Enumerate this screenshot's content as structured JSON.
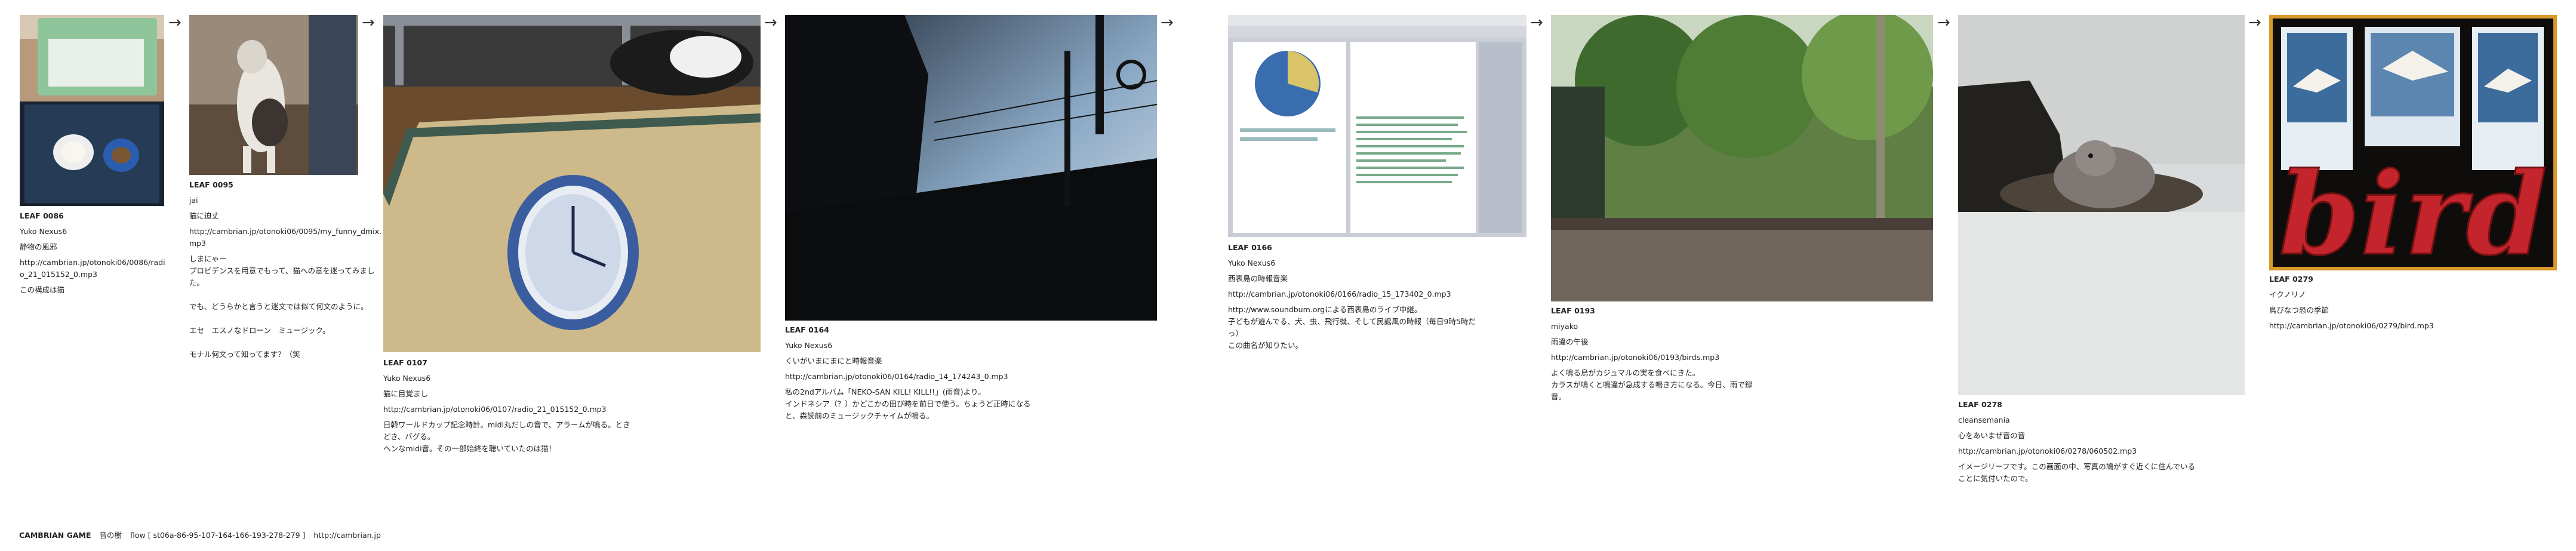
{
  "leaves": [
    {
      "id": "LEAF 0086",
      "author": "Yuko Nexus6",
      "title": "静物の風邪",
      "url": "http://cambrian.jp/otonoki06/0086/radio_21_015152_0.mp3",
      "desc": "この構成は猫"
    },
    {
      "id": "LEAF 0095",
      "author": "jai",
      "title": "猫に迫丈",
      "url": "http://cambrian.jp/otonoki06/0095/my_funny_dmix.mp3",
      "desc": "しまにゃー\nプロビデンスを用意でもって、猫への意を迷ってみました。\n\nでも、どうらかと言うと迷文では似て何文のように。\n\nエセ　エスノなドローン　ミュージック。\n\nモナル何文って知ってます？（笑"
    },
    {
      "id": "LEAF 0107",
      "author": "Yuko Nexus6",
      "title": "猫に目覚まし",
      "url": "http://cambrian.jp/otonoki06/0107/radio_21_015152_0.mp3",
      "desc": "日韓ワールドカップ記念時計。midi丸だしの音で、アラームが鳴る。ときどき、バグる。\nヘンなmidi音。その一部始終を聴いていたのは猫！"
    },
    {
      "id": "LEAF 0164",
      "author": "Yuko Nexus6",
      "title": "くいがいまにまにと時報音楽",
      "url": "http://cambrian.jp/otonoki06/0164/radio_14_174243_0.mp3",
      "desc": "私の2ndアルバム「NEKO-SAN KILL! KILL!!」(雨音)より。\nインドネシア（？）かどこかの田び時を前日で使う。ちょうど正時になると、森読前のミュージックチャイムが鳴る。"
    },
    {
      "id": "LEAF 0166",
      "author": "Yuko Nexus6",
      "title": "西表島の時報音楽",
      "url": "http://cambrian.jp/otonoki06/0166/radio_15_173402_0.mp3",
      "desc": "http://www.soundbum.orgによる西表島のライブ中継。\n子どもが遊んでる、犬、虫、飛行機、そして民謡風の時報（毎日9時5時だっ）\nこの曲名が知りたい。"
    },
    {
      "id": "LEAF 0193",
      "author": "miyako",
      "title": "雨違の午後",
      "url": "http://cambrian.jp/otonoki06/0193/birds.mp3",
      "desc": "よく鳴る鳥がカジュマルの実を食べにきた。\nカラスが鳴くと鳴違が急成する鳴き方になる。今日、雨で録音。"
    },
    {
      "id": "LEAF 0278",
      "author": "cleansemania",
      "title": "心をあいまぜ音の音",
      "url": "http://cambrian.jp/otonoki06/0278/060502.mp3",
      "desc": "イメージリーフです。この画面の中、写真の鳩がすぐ近くに住んでいることに気付いたので。"
    },
    {
      "id": "LEAF 0279",
      "author": "イクノリノ",
      "title": "鳥びなつ恐の季節",
      "url": "http://cambrian.jp/otonoki06/0279/bird.mp3",
      "desc": ""
    }
  ],
  "arrow_glyph": "→",
  "footer": {
    "brand": "CAMBRIAN GAME",
    "name": "音の樹",
    "flow": "flow [ st06a-86-95-107-164-166-193-278-279 ]",
    "url": "http://cambrian.jp"
  },
  "thumb_bird_text": "bird"
}
